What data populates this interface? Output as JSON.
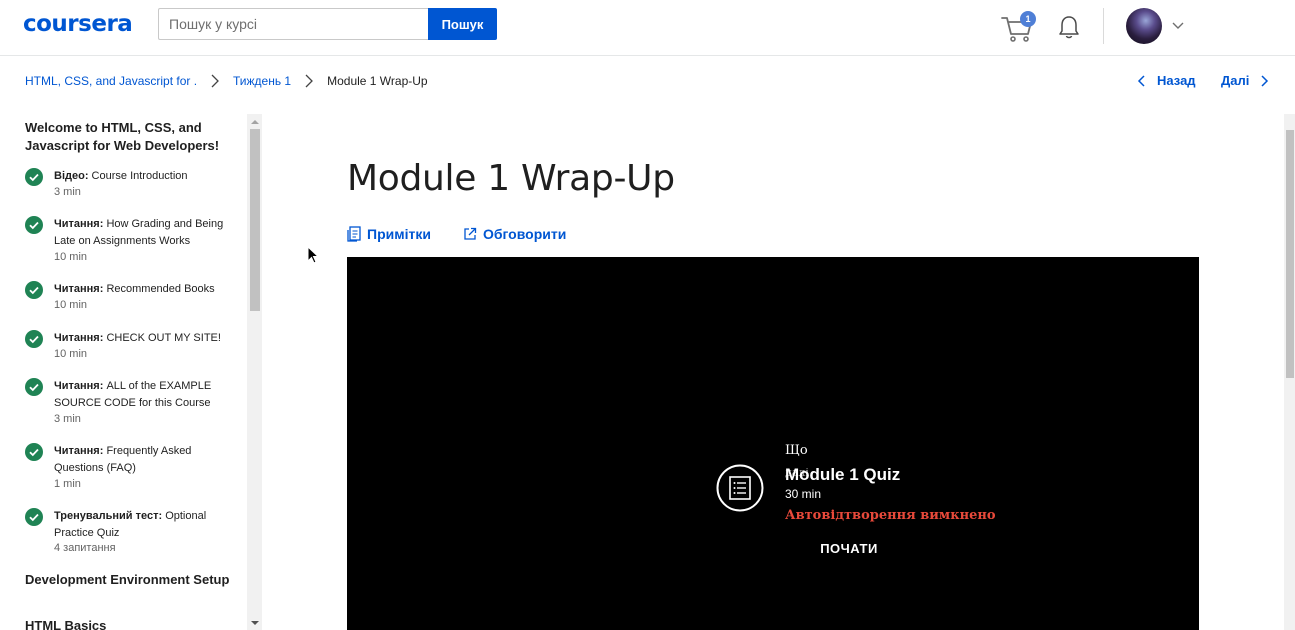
{
  "header": {
    "logo": "coursera",
    "search_placeholder": "Пошук у курсі",
    "search_button": "Пошук",
    "cart_count": "1",
    "icons": [
      "cart-icon",
      "bell-icon",
      "chevron-down-icon"
    ]
  },
  "breadcrumb": {
    "items": [
      "HTML, CSS, and Javascript for ...",
      "Тиждень 1",
      "Module 1 Wrap-Up"
    ]
  },
  "nav": {
    "prev": "Назад",
    "next": "Далі"
  },
  "sidebar": {
    "section1": "Welcome to HTML, CSS, and Javascript for Web Developers!",
    "items": [
      {
        "type": "Відео:",
        "title": "Course Introduction",
        "meta": "3 min"
      },
      {
        "type": "Читання:",
        "title": "How Grading and Being Late on Assignments Works",
        "meta": "10 min"
      },
      {
        "type": "Читання:",
        "title": "Recommended Books",
        "meta": "10 min"
      },
      {
        "type": "Читання:",
        "title": "CHECK OUT MY SITE!",
        "meta": "10 min"
      },
      {
        "type": "Читання:",
        "title": "ALL of the EXAMPLE SOURCE CODE for this Course",
        "meta": "3 min"
      },
      {
        "type": "Читання:",
        "title": "Frequently Asked Questions (FAQ)",
        "meta": "1 min"
      },
      {
        "type": "Тренувальний тест:",
        "title": "Optional Practice Quiz",
        "meta": "4 запитання"
      }
    ],
    "section2": "Development Environment Setup",
    "section3": "HTML Basics"
  },
  "main": {
    "title": "Module 1 Wrap-Up",
    "notes": "Примітки",
    "discuss": "Обговорити",
    "video": {
      "up_next_label": "Що",
      "up_next_label_2": "далі",
      "next_title": "Module 1 Quiz",
      "next_duration": "30 min",
      "autoplay": "Автовідтворення вимкнено",
      "start": "ПОЧАТИ"
    }
  },
  "colors": {
    "brand": "#0056d2",
    "success": "#1f8354",
    "autoplay_off": "#e8493a"
  }
}
